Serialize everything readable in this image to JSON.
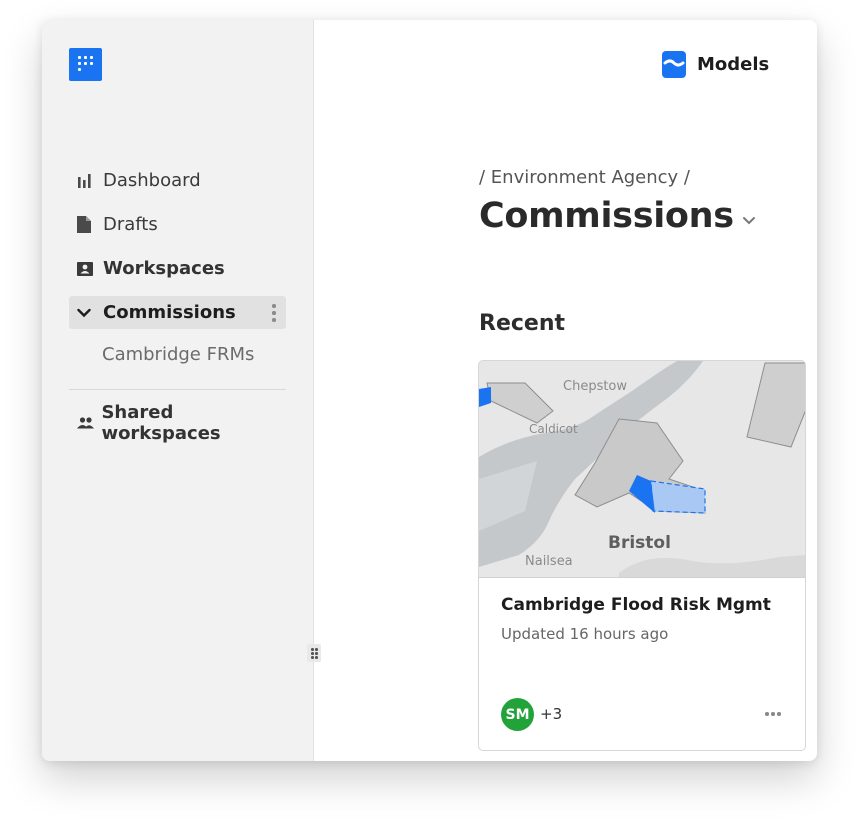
{
  "sidebar": {
    "logo_icon": "dot-grid-logo-icon",
    "items": [
      {
        "label": "Dashboard",
        "icon": "bar-chart-icon"
      },
      {
        "label": "Drafts",
        "icon": "document-icon"
      },
      {
        "label": "Workspaces",
        "icon": "workspace-icon"
      },
      {
        "label": "Commissions",
        "icon": "chevron-down-icon",
        "expanded": true,
        "active": true
      },
      {
        "label": "Cambridge FRMs"
      },
      {
        "label": "Shared workspaces",
        "icon": "people-icon"
      }
    ]
  },
  "header": {
    "app_badge": "Models",
    "app_icon": "models-icon"
  },
  "main": {
    "breadcrumb": "/ Environment Agency /",
    "title": "Commissions",
    "section_title": "Recent",
    "card": {
      "title": "Cambridge Flood Risk Mgmt",
      "updated": "Updated 16 hours ago",
      "avatar_initials": "SM",
      "avatar_color": "#21a33a",
      "more_count": "+3",
      "map_labels": {
        "chepstow": "Chepstow",
        "caldicot": "Caldicot",
        "bristol": "Bristol",
        "nailsea": "Nailsea"
      }
    }
  },
  "colors": {
    "accent": "#1a73f0",
    "sidebar_bg": "#f2f2f2",
    "active_bg": "#e1e1e1"
  }
}
